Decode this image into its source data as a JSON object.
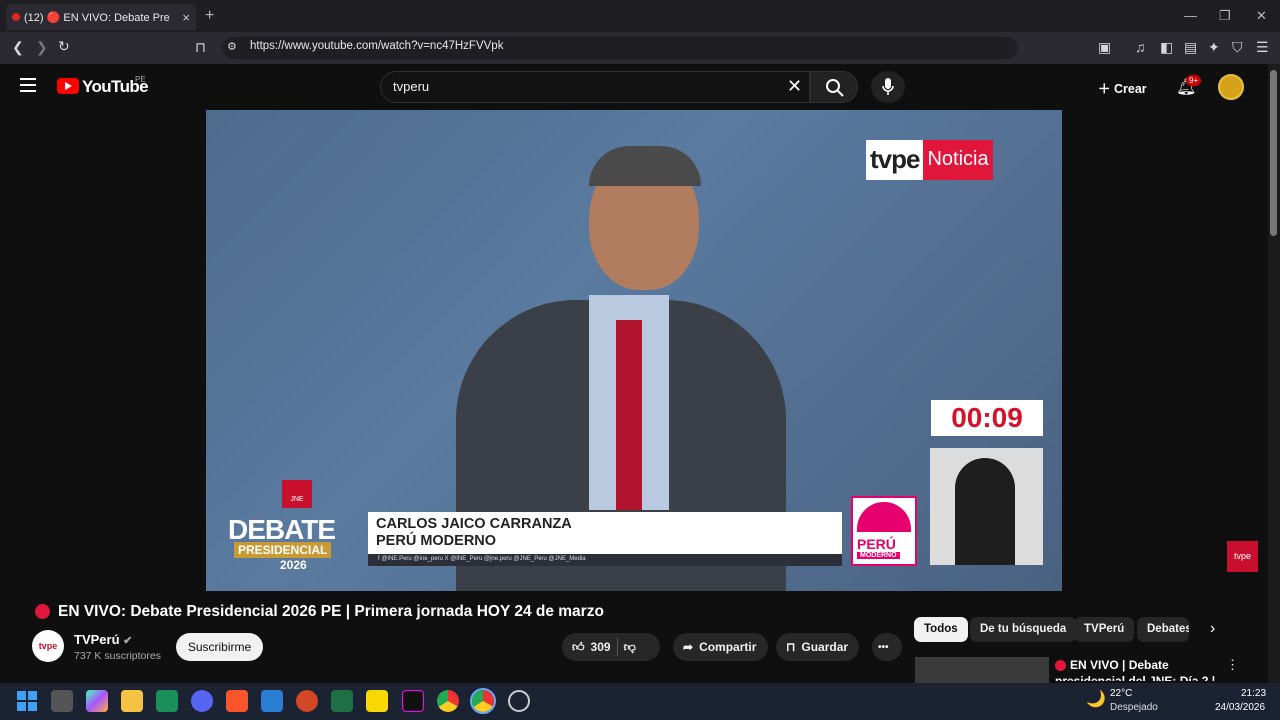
{
  "browser": {
    "tab_title": "(12) 🔴 EN VIVO: Debate Pre",
    "url": "https://www.youtube.com/watch?v=nc47HzFVVpk",
    "new_tab": "+",
    "tab_close": "×"
  },
  "youtube": {
    "logo": "YouTube",
    "country": "PE",
    "search_value": "tvperu",
    "create_label": "Crear",
    "notification_count": "9+"
  },
  "video": {
    "brand_tv": "tvpe",
    "brand_not": "Noticia",
    "timer": "00:09",
    "speaker_name": "CARLOS JAICO CARRANZA",
    "speaker_party": "PERÚ MODERNO",
    "social_line": "f @INE.Peru   @ine_peru   X @INE_Peru   @jne.peru   @JNE_Peru   @JNE_Media",
    "logo_debate": "DEBATE",
    "logo_presidencial": "PRESIDENCIAL",
    "logo_year": "2026",
    "logo_ine": "JNE",
    "party_logo_1": "PERÚ",
    "party_logo_2": "MODERNO",
    "side_logo": "tvpe"
  },
  "info": {
    "title": "EN VIVO: Debate Presidencial 2026 PE | Primera jornada HOY 24 de marzo",
    "channel": "TVPerú",
    "channel_avatar": "tvpe",
    "subscribers": "737 K suscriptores",
    "subscribe": "Suscribirme",
    "likes": "309",
    "share": "Compartir",
    "save": "Guardar",
    "more": "•••"
  },
  "chips": [
    "Todos",
    "De tu búsqueda",
    "TVPerú",
    "Debates"
  ],
  "recommendation": {
    "title": "EN VIVO | Debate presidencial del JNE: Día 2 |"
  },
  "taskbar": {
    "temp": "22°C",
    "weather": "Despejado",
    "time": "21:23",
    "date": "24/03/2026"
  }
}
